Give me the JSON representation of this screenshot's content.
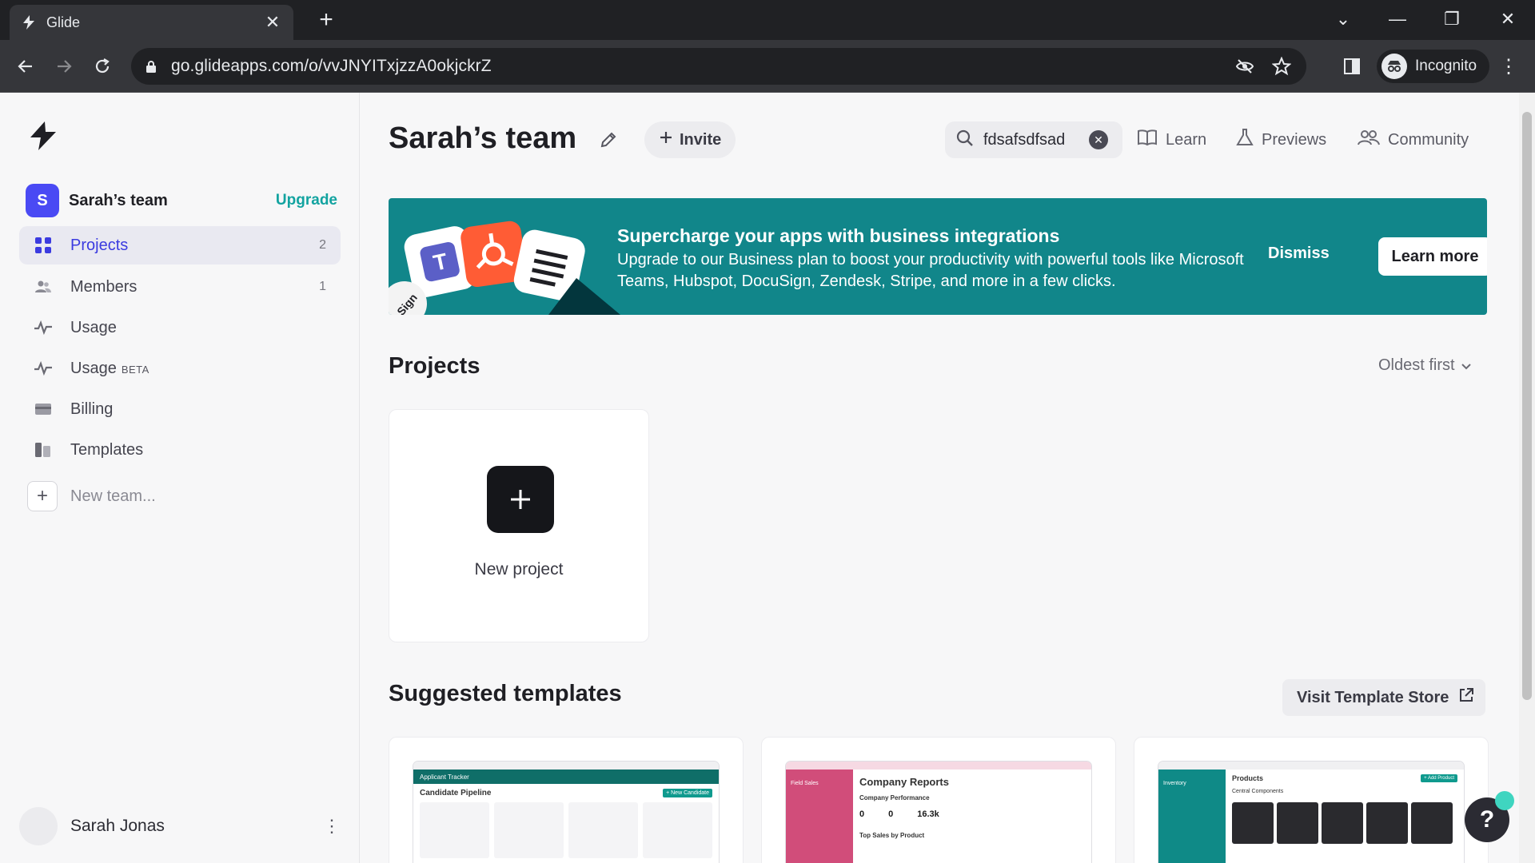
{
  "browser": {
    "tab_title": "Glide",
    "url": "go.glideapps.com/o/vvJNYITxjzzA0okjckrZ",
    "profile_label": "Incognito"
  },
  "sidebar": {
    "team_initial": "S",
    "team_name": "Sarah’s team",
    "upgrade_label": "Upgrade",
    "items": [
      {
        "label": "Projects",
        "count": "2",
        "icon": "grid-icon",
        "active": true
      },
      {
        "label": "Members",
        "count": "1",
        "icon": "people-icon"
      },
      {
        "label": "Usage",
        "icon": "pulse-icon"
      },
      {
        "label": "Usage",
        "badge": "BETA",
        "icon": "pulse-icon"
      },
      {
        "label": "Billing",
        "icon": "card-icon"
      },
      {
        "label": "Templates",
        "icon": "template-icon"
      }
    ],
    "new_team_label": "New team...",
    "user_name": "Sarah Jonas"
  },
  "header": {
    "title": "Sarah’s team",
    "invite_label": "Invite",
    "search_value": "fdsafsdfsad",
    "links": [
      {
        "label": "Learn",
        "icon": "book-icon"
      },
      {
        "label": "Previews",
        "icon": "flask-icon"
      },
      {
        "label": "Community",
        "icon": "people-icon"
      }
    ]
  },
  "banner": {
    "title": "Supercharge your apps with business integrations",
    "text": "Upgrade to our Business plan to boost your productivity with powerful tools like Microsoft Teams, Hubspot, DocuSign, Zendesk, Stripe, and more in a few clicks.",
    "dismiss_label": "Dismiss",
    "learn_more_label": "Learn more",
    "colors": {
      "background": "#11868a"
    }
  },
  "projects": {
    "title": "Projects",
    "sort_label": "Oldest first",
    "new_project_label": "New project"
  },
  "templates": {
    "title": "Suggested templates",
    "store_label": "Visit Template Store",
    "cards": [
      {
        "app_name": "Applicant Tracker",
        "heading": "Candidate Pipeline",
        "action": "+ New Candidate"
      },
      {
        "app_name": "Field Sales",
        "heading": "Company Reports",
        "subheading": "Company Performance",
        "metrics": [
          "0",
          "0",
          "16.3k"
        ],
        "footer": "Top Sales by Product"
      },
      {
        "app_name": "Inventory",
        "heading": "Products",
        "subheading": "Central Components",
        "action": "+ Add Product"
      }
    ]
  },
  "help": {
    "label": "?"
  }
}
